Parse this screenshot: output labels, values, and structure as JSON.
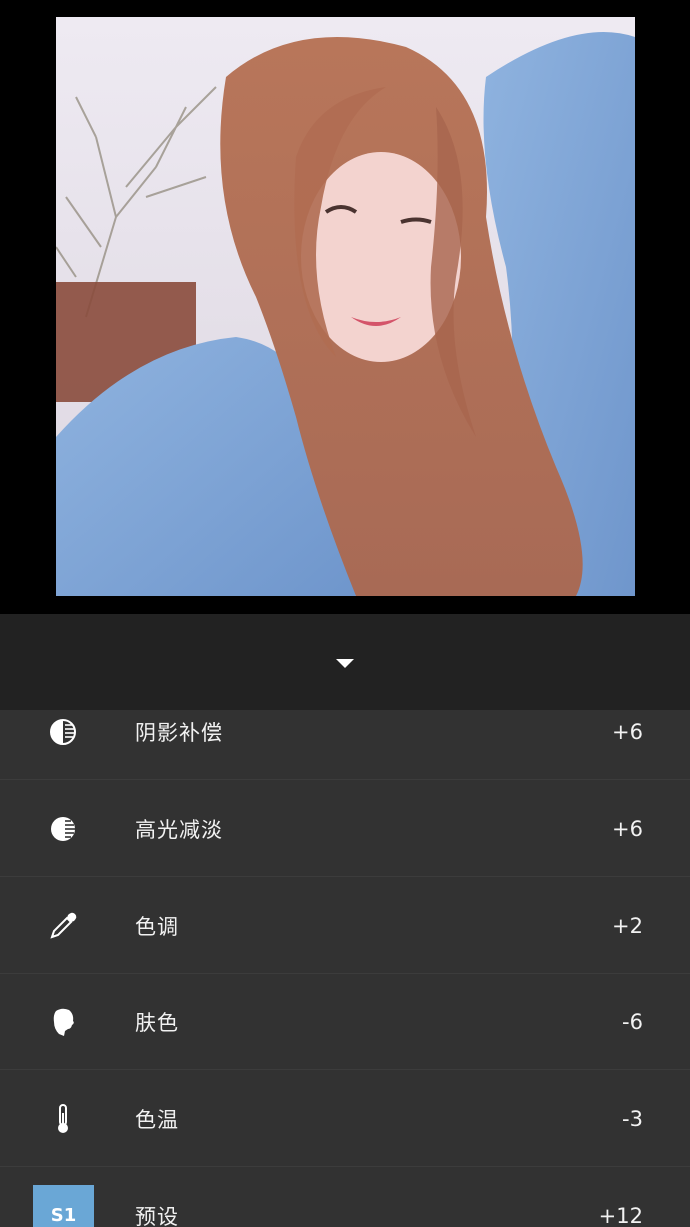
{
  "settings": [
    {
      "label": "阴影补偿",
      "value": "+6",
      "icon": "shadow-compensation-icon"
    },
    {
      "label": "高光减淡",
      "value": "+6",
      "icon": "highlight-reduction-icon"
    },
    {
      "label": "色调",
      "value": "+2",
      "icon": "eyedropper-icon"
    },
    {
      "label": "肤色",
      "value": "-6",
      "icon": "face-profile-icon"
    },
    {
      "label": "色温",
      "value": "-3",
      "icon": "thermometer-icon"
    },
    {
      "label": "预设",
      "value": "+12",
      "icon": "preset-badge",
      "badge": "S1"
    }
  ],
  "colors": {
    "panel_bg": "#323232",
    "collapse_bar_bg": "#222222",
    "preset_badge": "#6aa7d6",
    "text": "#f2f2f2"
  }
}
